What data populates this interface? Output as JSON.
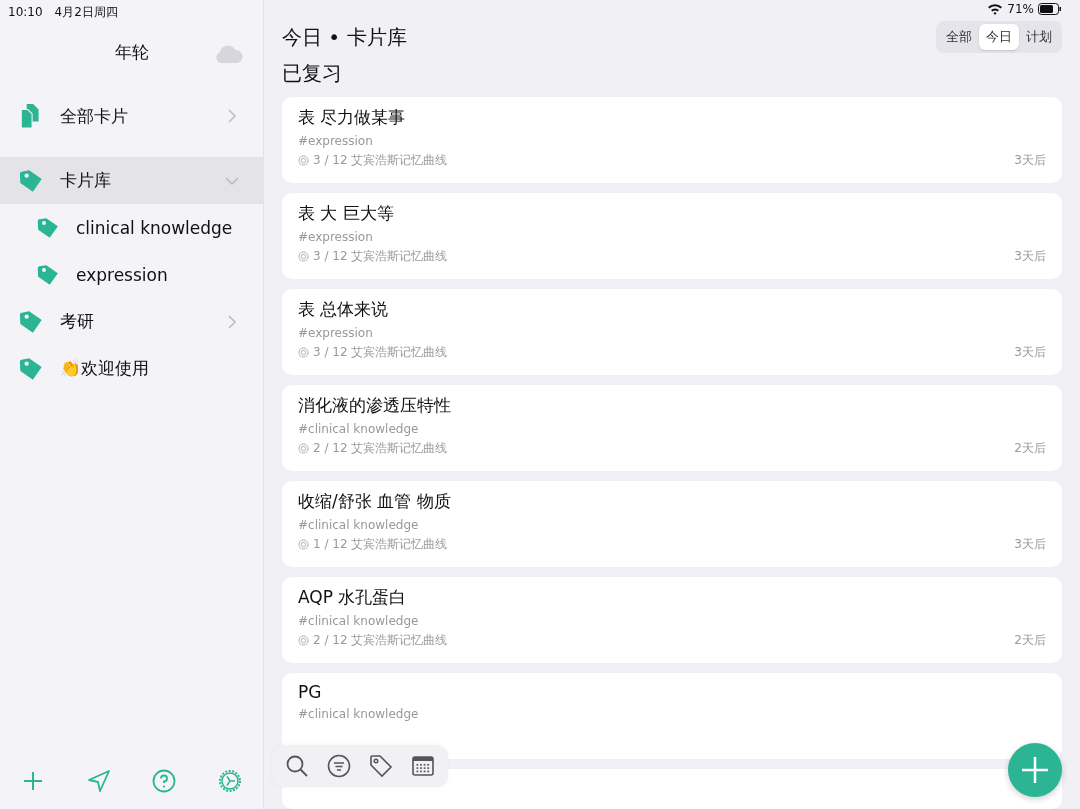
{
  "status_bar": {
    "time": "10:10",
    "date": "4月2日周四",
    "battery": "71%"
  },
  "sidebar": {
    "title": "年轮",
    "items": [
      {
        "label": "全部卡片",
        "kind": "all",
        "expanded": false,
        "selected": false
      },
      {
        "label": "卡片库",
        "kind": "tag",
        "expanded": true,
        "selected": true,
        "children": [
          {
            "label": "clinical knowledge",
            "kind": "tag",
            "selected": false
          },
          {
            "label": "expression",
            "kind": "tag",
            "selected": false
          }
        ]
      },
      {
        "label": "考研",
        "kind": "tag",
        "expanded": false,
        "selected": false
      },
      {
        "label": "👏欢迎使用",
        "kind": "tag",
        "selected": false
      }
    ]
  },
  "header": {
    "title": "今日 • 卡片库",
    "tabs": [
      {
        "label": "全部",
        "selected": false
      },
      {
        "label": "今日",
        "selected": true
      },
      {
        "label": "计划",
        "selected": false
      }
    ]
  },
  "section_title": "已复习",
  "cards": [
    {
      "title": "表 尽力做某事",
      "tag": "#expression",
      "progress": "3 / 12 艾宾浩斯记忆曲线",
      "due": "3天后"
    },
    {
      "title": "表 大 巨大等",
      "tag": "#expression",
      "progress": "3 / 12 艾宾浩斯记忆曲线",
      "due": "3天后"
    },
    {
      "title": "表 总体来说",
      "tag": "#expression",
      "progress": "3 / 12 艾宾浩斯记忆曲线",
      "due": "3天后"
    },
    {
      "title": "消化液的渗透压特性",
      "tag": "#clinical knowledge",
      "progress": "2 / 12 艾宾浩斯记忆曲线",
      "due": "2天后"
    },
    {
      "title": "收缩/舒张 血管 物质",
      "tag": "#clinical knowledge",
      "progress": "1 / 12 艾宾浩斯记忆曲线",
      "due": "3天后"
    },
    {
      "title": "AQP 水孔蛋白",
      "tag": "#clinical knowledge",
      "progress": "2 / 12 艾宾浩斯记忆曲线",
      "due": "2天后"
    },
    {
      "title": "PG",
      "tag": "#clinical knowledge"
    }
  ]
}
